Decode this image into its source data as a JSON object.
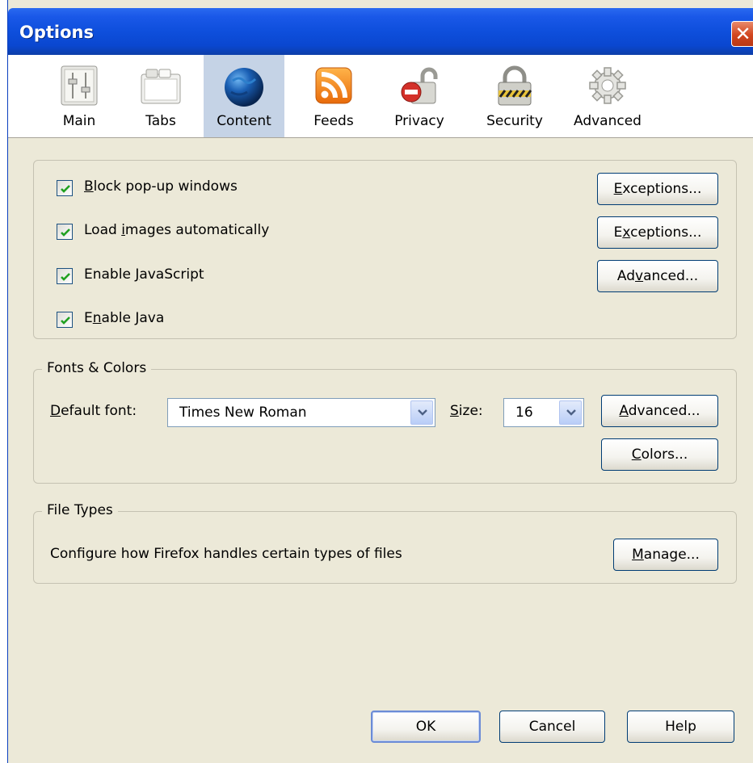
{
  "window": {
    "title": "Options",
    "close_glyph": "✕"
  },
  "toolbar": {
    "tabs": [
      {
        "label": "Main",
        "icon": "main-settings-icon"
      },
      {
        "label": "Tabs",
        "icon": "tabs-icon"
      },
      {
        "label": "Content",
        "icon": "globe-icon",
        "selected": true
      },
      {
        "label": "Feeds",
        "icon": "rss-feed-icon"
      },
      {
        "label": "Privacy",
        "icon": "privacy-lock-icon"
      },
      {
        "label": "Security",
        "icon": "security-padlock-icon"
      },
      {
        "label": "Advanced",
        "icon": "gear-icon"
      }
    ]
  },
  "content_group": {
    "block_popups": {
      "pre": "",
      "u": "B",
      "post": "lock pop-up windows",
      "checked": true
    },
    "load_images": {
      "pre": "Load ",
      "u": "i",
      "post": "mages automatically",
      "checked": true
    },
    "enable_js": {
      "pre": "Enable ",
      "u": "J",
      "post": "avaScript",
      "checked": true
    },
    "enable_java": {
      "pre": "E",
      "u": "n",
      "post": "able Java",
      "checked": true
    },
    "exceptions1": {
      "pre": "",
      "u": "E",
      "post": "xceptions..."
    },
    "exceptions2": {
      "pre": "E",
      "u": "x",
      "post": "ceptions..."
    },
    "advanced_js": {
      "pre": "Ad",
      "u": "v",
      "post": "anced..."
    }
  },
  "fonts_group": {
    "legend": "Fonts & Colors",
    "default_font_label": {
      "pre": "",
      "u": "D",
      "post": "efault font:"
    },
    "default_font_value": "Times New Roman",
    "size_label": {
      "pre": "",
      "u": "S",
      "post": "ize:"
    },
    "size_value": "16",
    "advanced": {
      "pre": "",
      "u": "A",
      "post": "dvanced..."
    },
    "colors": {
      "pre": "",
      "u": "C",
      "post": "olors..."
    }
  },
  "filetypes_group": {
    "legend": "File Types",
    "description": "Configure how Firefox handles certain types of files",
    "manage": {
      "pre": "",
      "u": "M",
      "post": "anage..."
    }
  },
  "footer": {
    "ok": "OK",
    "cancel": "Cancel",
    "help": "Help"
  },
  "colors": {
    "title_bar": "#0e4fdc",
    "dialog_bg": "#ece9d8",
    "check": "#21a121",
    "selected_tab": "#c5d3e6"
  }
}
